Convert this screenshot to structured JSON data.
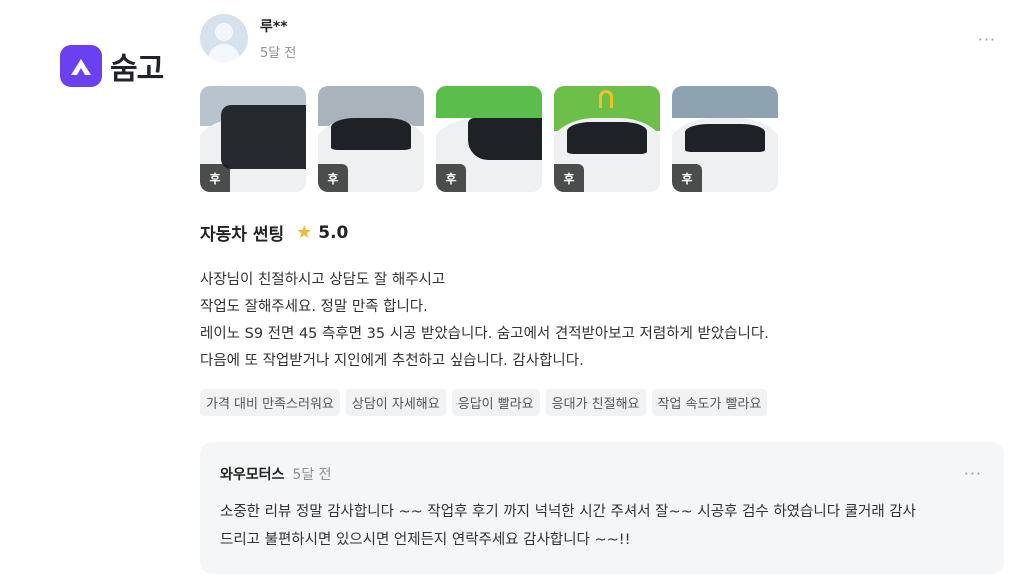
{
  "brand": {
    "name": "숨고",
    "color": "#6a40f0"
  },
  "review": {
    "author": "루**",
    "date": "5달 전",
    "more_label": "···",
    "photo_badge": "후",
    "photos": [
      "후",
      "후",
      "후",
      "후",
      "후"
    ],
    "service": "자동차 썬팅",
    "star_icon": "star-icon",
    "rating": "5.0",
    "lines": [
      "사장님이 친절하시고 상담도 잘 해주시고",
      "작업도 잘해주세요. 정말 만족 합니다.",
      "레이노 S9 전면 45 측후면 35 시공 받았습니다. 숨고에서 견적받아보고 저렴하게 받았습니다.",
      "다음에 또 작업받거나 지인에게 추천하고 싶습니다. 감사합니다."
    ],
    "tags": [
      "가격 대비 만족스러워요",
      "상담이 자세해요",
      "응답이 빨라요",
      "응대가 친절해요",
      "작업 속도가 빨라요"
    ]
  },
  "reply": {
    "name": "와우모터스",
    "date": "5달 전",
    "more_label": "···",
    "lines": [
      "소중한 리뷰 정말 감사합니다 ~~ 작업후 후기 까지 넉넉한 시간 주셔서 잘~~ 시공후 검수 하였습니다 쿨거래 감사",
      "드리고 불편하시면 있으시면 언제든지 연락주세요 감사합니다 ~~!!"
    ]
  }
}
